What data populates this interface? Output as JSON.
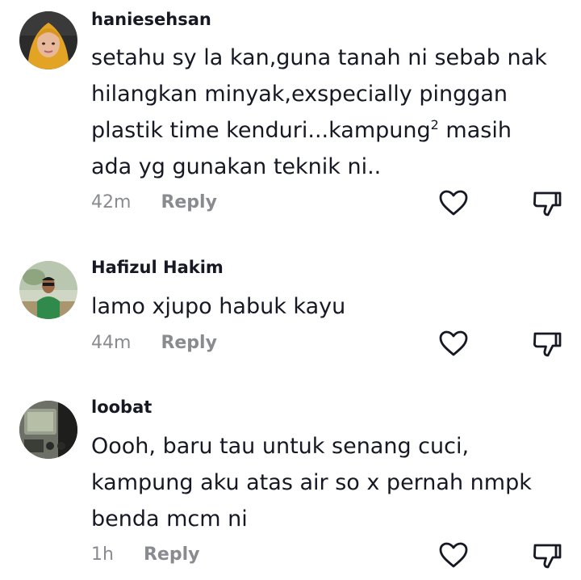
{
  "comments": [
    {
      "username": "haniesehsan",
      "text_line1": "setahu sy la kan,guna tanah ni sebab nak",
      "text_line2": "hilangkan minyak,exspecially pinggan",
      "text_line3_pre": "plastik time kenduri...kampung",
      "text_line3_sup": "2",
      "text_line3_post": " masih",
      "text_line4": "ada yg gunakan teknik ni..",
      "time": "42m",
      "reply_label": "Reply",
      "avatar_icon": "avatar-hijab-woman"
    },
    {
      "username": "Hafizul Hakim",
      "text_line1": "lamo xjupo habuk kayu",
      "time": "44m",
      "reply_label": "Reply",
      "avatar_icon": "avatar-man-green-shirt"
    },
    {
      "username": "loobat",
      "text_line1": "Oooh, baru tau untuk senang cuci,",
      "text_line2": "kampung aku atas air so x pernah nmpk",
      "text_line3": "benda mcm ni",
      "time": "1h",
      "reply_label": "Reply",
      "avatar_icon": "avatar-device-photo"
    }
  ],
  "icons": {
    "like": "heart-outline-icon",
    "dislike": "thumbs-down-outline-icon"
  },
  "colors": {
    "text": "#161823",
    "meta": "#8a8b91",
    "icon_stroke": "#161823"
  }
}
